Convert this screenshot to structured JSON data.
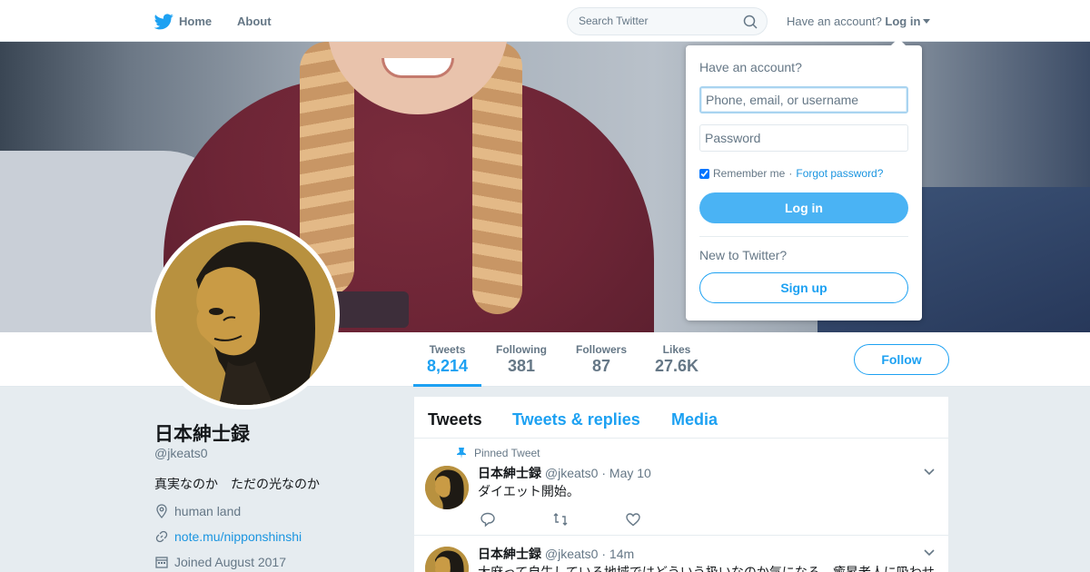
{
  "nav": {
    "home": "Home",
    "about": "About",
    "search_placeholder": "Search Twitter",
    "have_account": "Have an account?",
    "login": "Log in"
  },
  "login_dropdown": {
    "title": "Have an account?",
    "username_placeholder": "Phone, email, or username",
    "password_placeholder": "Password",
    "remember": "Remember me",
    "separator": "·",
    "forgot": "Forgot password?",
    "login_button": "Log in",
    "new_to_twitter": "New to Twitter?",
    "signup_button": "Sign up",
    "remember_checked": true
  },
  "stats": [
    {
      "label": "Tweets",
      "value": "8,214"
    },
    {
      "label": "Following",
      "value": "381"
    },
    {
      "label": "Followers",
      "value": "87"
    },
    {
      "label": "Likes",
      "value": "27.6K"
    }
  ],
  "follow_button": "Follow",
  "profile": {
    "name": "日本紳士録",
    "handle": "@jkeats0",
    "bio": "真実なのか　ただの光なのか",
    "location": "human land",
    "link": "note.mu/nipponshinshi",
    "joined": "Joined August 2017"
  },
  "tabs": [
    "Tweets",
    "Tweets & replies",
    "Media"
  ],
  "tweets": [
    {
      "pinned_label": "Pinned Tweet",
      "name": "日本紳士録",
      "handle": "@jkeats0",
      "time": "· May 10",
      "text": "ダイエット開始。"
    },
    {
      "name": "日本紳士録",
      "handle": "@jkeats0",
      "time": "· 14m",
      "text": "大麻って自生している地域ではどういう扱いなのか気になる。癒昇老人に吸わせ"
    }
  ],
  "colors": {
    "accent": "#1da1f2",
    "muted": "#657786",
    "background": "#e6ecf0"
  }
}
